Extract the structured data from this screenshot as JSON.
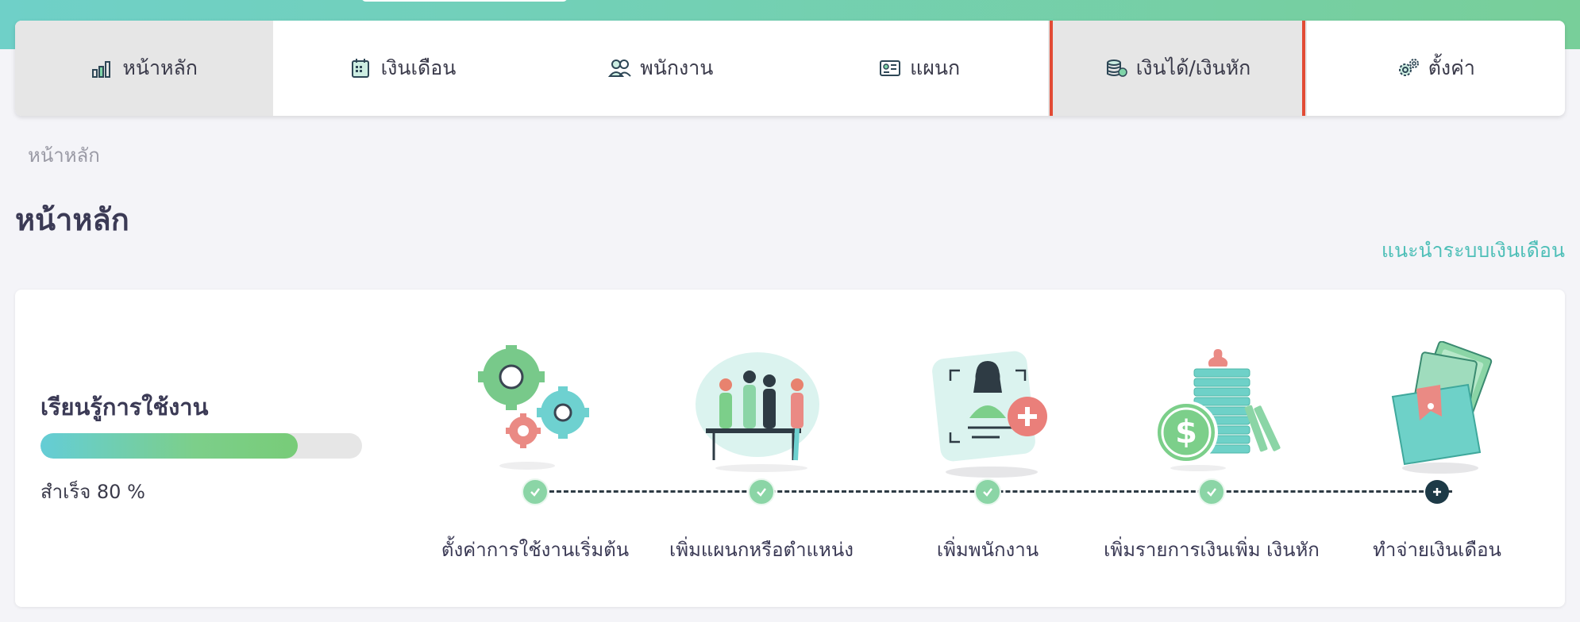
{
  "nav": {
    "items": [
      {
        "label": "หน้าหลัก",
        "icon": "bar-chart-icon"
      },
      {
        "label": "เงินเดือน",
        "icon": "calendar-icon"
      },
      {
        "label": "พนักงาน",
        "icon": "users-icon"
      },
      {
        "label": "แผนก",
        "icon": "id-card-icon"
      },
      {
        "label": "เงินได้/เงินหัก",
        "icon": "money-stack-icon"
      },
      {
        "label": "ตั้งค่า",
        "icon": "gears-icon"
      }
    ]
  },
  "breadcrumb": "หน้าหลัก",
  "page_title": "หน้าหลัก",
  "guide_link": "แนะนำระบบเงินเดือน",
  "learning": {
    "title": "เรียนรู้การใช้งาน",
    "progress_percent": 80,
    "progress_text": "สำเร็จ 80 %"
  },
  "steps": [
    {
      "label": "ตั้งค่าการใช้งานเริ่มต้น",
      "status": "done",
      "illustration": "gears-illustration"
    },
    {
      "label": "เพิ่มแผนกหรือตำแหน่ง",
      "status": "done",
      "illustration": "team-illustration"
    },
    {
      "label": "เพิ่มพนักงาน",
      "status": "done",
      "illustration": "add-employee-illustration"
    },
    {
      "label": "เพิ่มรายการเงินเพิ่ม เงินหัก",
      "status": "done",
      "illustration": "coins-illustration"
    },
    {
      "label": "ทำจ่ายเงินเดือน",
      "status": "todo",
      "illustration": "wallet-illustration"
    }
  ],
  "colors": {
    "accent": "#4fbfb8",
    "highlight_border": "#e24b35",
    "title": "#3b3a55"
  }
}
